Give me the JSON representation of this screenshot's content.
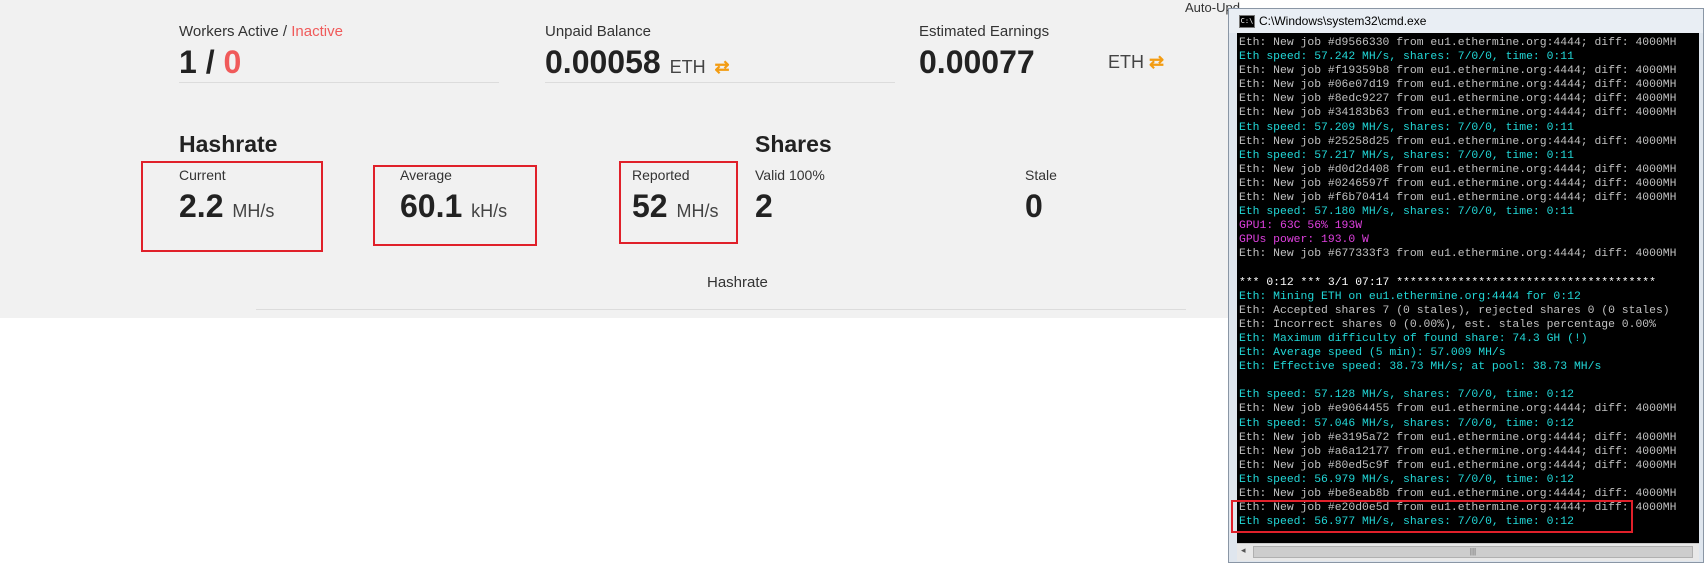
{
  "dashboard": {
    "auto_update_label": "Auto-Upd",
    "workers": {
      "label": "Workers Active / ",
      "label_inactive": "Inactive",
      "active": "1 / ",
      "inactive": "0"
    },
    "unpaid": {
      "label": "Unpaid Balance",
      "value": "0.00058",
      "unit": "ETH"
    },
    "estimated": {
      "label": "Estimated Earnings",
      "value": "0.00077",
      "unit": "ETH"
    },
    "hashrate": {
      "title": "Hashrate",
      "current": {
        "label": "Current",
        "value": "2.2",
        "unit": "MH/s"
      },
      "average": {
        "label": "Average",
        "value": "60.1",
        "unit": "kH/s"
      },
      "reported": {
        "label": "Reported",
        "value": "52",
        "unit": "MH/s"
      }
    },
    "shares": {
      "title": "Shares",
      "valid": {
        "label": "Valid 100%",
        "value": "2"
      },
      "stale": {
        "label": "Stale",
        "value": "0"
      }
    },
    "chart_heading": "Hashrate"
  },
  "cmd_window": {
    "title": "C:\\Windows\\system32\\cmd.exe",
    "lines": [
      {
        "text": "Eth: New job #d9566330 from eu1.ethermine.org:4444; diff: 4000MH",
        "color": "#c0c0c0"
      },
      {
        "text": "Eth speed: 57.242 MH/s, shares: 7/0/0, time: 0:11",
        "color": "#22d8d8"
      },
      {
        "text": "Eth: New job #f19359b8 from eu1.ethermine.org:4444; diff: 4000MH",
        "color": "#c0c0c0"
      },
      {
        "text": "Eth: New job #06e07d19 from eu1.ethermine.org:4444; diff: 4000MH",
        "color": "#c0c0c0"
      },
      {
        "text": "Eth: New job #8edc9227 from eu1.ethermine.org:4444; diff: 4000MH",
        "color": "#c0c0c0"
      },
      {
        "text": "Eth: New job #34183b63 from eu1.ethermine.org:4444; diff: 4000MH",
        "color": "#c0c0c0"
      },
      {
        "text": "Eth speed: 57.209 MH/s, shares: 7/0/0, time: 0:11",
        "color": "#22d8d8"
      },
      {
        "text": "Eth: New job #25258d25 from eu1.ethermine.org:4444; diff: 4000MH",
        "color": "#c0c0c0"
      },
      {
        "text": "Eth speed: 57.217 MH/s, shares: 7/0/0, time: 0:11",
        "color": "#22d8d8"
      },
      {
        "text": "Eth: New job #d0d2d408 from eu1.ethermine.org:4444; diff: 4000MH",
        "color": "#c0c0c0"
      },
      {
        "text": "Eth: New job #0246597f from eu1.ethermine.org:4444; diff: 4000MH",
        "color": "#c0c0c0"
      },
      {
        "text": "Eth: New job #f6b70414 from eu1.ethermine.org:4444; diff: 4000MH",
        "color": "#c0c0c0"
      },
      {
        "text": "Eth speed: 57.180 MH/s, shares: 7/0/0, time: 0:11",
        "color": "#22d8d8"
      },
      {
        "text": "GPU1: 63C 56% 193W",
        "color": "#e040e0"
      },
      {
        "text": "GPUs power: 193.0 W",
        "color": "#e040e0"
      },
      {
        "text": "Eth: New job #677333f3 from eu1.ethermine.org:4444; diff: 4000MH",
        "color": "#c0c0c0"
      },
      {
        "text": " ",
        "color": "#c0c0c0"
      },
      {
        "text": "*** 0:12 *** 3/1 07:17 **************************************",
        "color": "#ffffff"
      },
      {
        "text": "Eth: Mining ETH on eu1.ethermine.org:4444 for 0:12",
        "color": "#22d8d8"
      },
      {
        "text": "Eth: Accepted shares 7 (0 stales), rejected shares 0 (0 stales)",
        "color": "#c0c0c0"
      },
      {
        "text": "Eth: Incorrect shares 0 (0.00%), est. stales percentage 0.00%",
        "color": "#c0c0c0"
      },
      {
        "text": "Eth: Maximum difficulty of found share: 74.3 GH (!)",
        "color": "#22d8d8"
      },
      {
        "text": "Eth: Average speed (5 min): 57.009 MH/s",
        "color": "#22d8d8"
      },
      {
        "text": "Eth: Effective speed: 38.73 MH/s; at pool: 38.73 MH/s",
        "color": "#22d8d8"
      },
      {
        "text": " ",
        "color": "#c0c0c0"
      },
      {
        "text": "Eth speed: 57.128 MH/s, shares: 7/0/0, time: 0:12",
        "color": "#22d8d8"
      },
      {
        "text": "Eth: New job #e9064455 from eu1.ethermine.org:4444; diff: 4000MH",
        "color": "#c0c0c0"
      },
      {
        "text": "Eth speed: 57.046 MH/s, shares: 7/0/0, time: 0:12",
        "color": "#22d8d8"
      },
      {
        "text": "Eth: New job #e3195a72 from eu1.ethermine.org:4444; diff: 4000MH",
        "color": "#c0c0c0"
      },
      {
        "text": "Eth: New job #a6a12177 from eu1.ethermine.org:4444; diff: 4000MH",
        "color": "#c0c0c0"
      },
      {
        "text": "Eth: New job #80ed5c9f from eu1.ethermine.org:4444; diff: 4000MH",
        "color": "#c0c0c0"
      },
      {
        "text": "Eth speed: 56.979 MH/s, shares: 7/0/0, time: 0:12",
        "color": "#22d8d8"
      },
      {
        "text": "Eth: New job #be8eab8b from eu1.ethermine.org:4444; diff: 4000MH",
        "color": "#c0c0c0"
      },
      {
        "text": "Eth: New job #e20d0e5d from eu1.ethermine.org:4444; diff: 4000MH",
        "color": "#c0c0c0"
      },
      {
        "text": "Eth speed: 56.977 MH/s, shares: 7/0/0, time: 0:12",
        "color": "#22d8d8"
      }
    ]
  },
  "colors": {
    "accent_red": "#f05a5a",
    "highlight_box": "#e0202a",
    "swap_icon": "#f39c12"
  }
}
